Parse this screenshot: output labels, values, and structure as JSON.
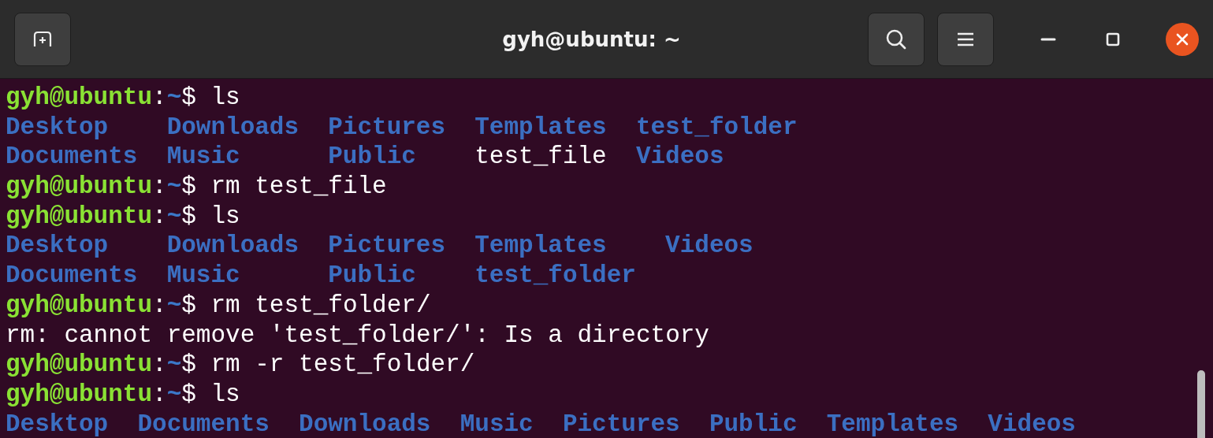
{
  "window": {
    "title": "gyh@ubuntu: ~"
  },
  "terminal": {
    "lines": [
      {
        "kind": "prompt",
        "user_host": "gyh@ubuntu",
        "separator": ":",
        "path": "~",
        "symbol": "$",
        "command": "ls"
      },
      {
        "kind": "listing",
        "rows": [
          [
            {
              "name": "Desktop",
              "kind": "directory"
            },
            {
              "name": "Downloads",
              "kind": "directory"
            },
            {
              "name": "Pictures",
              "kind": "directory"
            },
            {
              "name": "Templates",
              "kind": "directory"
            },
            {
              "name": "test_folder",
              "kind": "directory"
            }
          ],
          [
            {
              "name": "Documents",
              "kind": "directory"
            },
            {
              "name": "Music",
              "kind": "directory"
            },
            {
              "name": "Public",
              "kind": "directory"
            },
            {
              "name": "test_file",
              "kind": "file"
            },
            {
              "name": "Videos",
              "kind": "directory"
            }
          ]
        ]
      },
      {
        "kind": "prompt",
        "user_host": "gyh@ubuntu",
        "separator": ":",
        "path": "~",
        "symbol": "$",
        "command": "rm test_file"
      },
      {
        "kind": "prompt",
        "user_host": "gyh@ubuntu",
        "separator": ":",
        "path": "~",
        "symbol": "$",
        "command": "ls"
      },
      {
        "kind": "listing",
        "rows": [
          [
            {
              "name": "Desktop",
              "kind": "directory"
            },
            {
              "name": "Downloads",
              "kind": "directory"
            },
            {
              "name": "Pictures",
              "kind": "directory"
            },
            {
              "name": "Templates",
              "kind": "directory"
            },
            {
              "name": "Videos",
              "kind": "directory"
            }
          ],
          [
            {
              "name": "Documents",
              "kind": "directory"
            },
            {
              "name": "Music",
              "kind": "directory"
            },
            {
              "name": "Public",
              "kind": "directory"
            },
            {
              "name": "test_folder",
              "kind": "directory"
            }
          ]
        ]
      },
      {
        "kind": "prompt",
        "user_host": "gyh@ubuntu",
        "separator": ":",
        "path": "~",
        "symbol": "$",
        "command": "rm test_folder/"
      },
      {
        "kind": "output",
        "text": "rm: cannot remove 'test_folder/': Is a directory"
      },
      {
        "kind": "prompt",
        "user_host": "gyh@ubuntu",
        "separator": ":",
        "path": "~",
        "symbol": "$",
        "command": "rm -r test_folder/"
      },
      {
        "kind": "prompt",
        "user_host": "gyh@ubuntu",
        "separator": ":",
        "path": "~",
        "symbol": "$",
        "command": "ls"
      },
      {
        "kind": "listing",
        "rows": [
          [
            {
              "name": "Desktop",
              "kind": "directory"
            },
            {
              "name": "Documents",
              "kind": "directory"
            },
            {
              "name": "Downloads",
              "kind": "directory"
            },
            {
              "name": "Music",
              "kind": "directory"
            },
            {
              "name": "Pictures",
              "kind": "directory"
            },
            {
              "name": "Public",
              "kind": "directory"
            },
            {
              "name": "Templates",
              "kind": "directory"
            },
            {
              "name": "Videos",
              "kind": "directory"
            }
          ]
        ]
      }
    ]
  }
}
